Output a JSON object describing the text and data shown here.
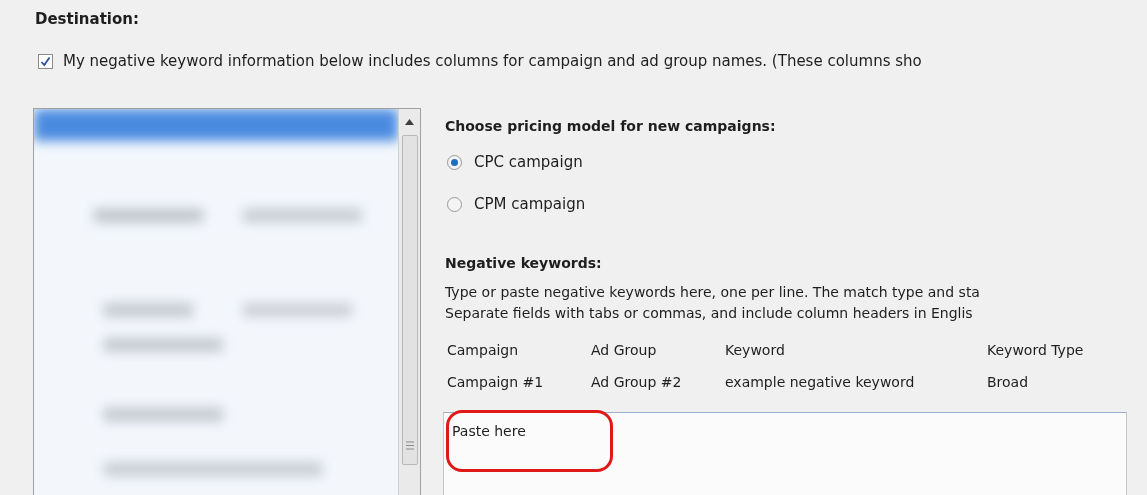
{
  "destination": {
    "title": "Destination:",
    "checkbox": {
      "label": "My negative keyword information below includes columns for campaign and ad group names. (These columns sho",
      "checked": true
    }
  },
  "pricing": {
    "title": "Choose pricing model for new campaigns:",
    "options": [
      {
        "label": "CPC campaign",
        "selected": true
      },
      {
        "label": "CPM campaign",
        "selected": false
      }
    ]
  },
  "negative_keywords": {
    "title": "Negative keywords:",
    "description": [
      "Type or paste negative keywords here, one per line. The match type and sta",
      "Separate fields with tabs or commas, and include column headers in Englis"
    ],
    "columns": [
      "Campaign",
      "Ad Group",
      "Keyword",
      "Keyword Type"
    ],
    "example_row": [
      "Campaign #1",
      "Ad Group #2",
      "example negative keyword",
      "Broad"
    ],
    "field": {
      "value": "Paste here"
    }
  }
}
